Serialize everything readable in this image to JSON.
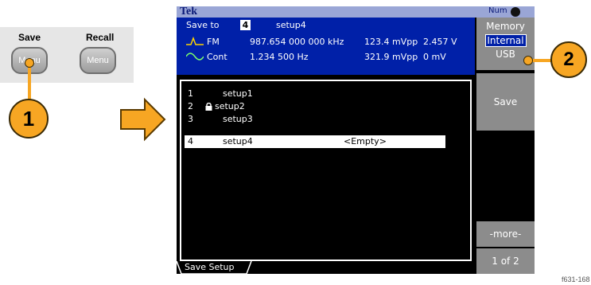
{
  "panel": {
    "save_label": "Save",
    "recall_label": "Recall",
    "save_button_text": "Menu",
    "recall_button_text": "Menu"
  },
  "callouts": {
    "first": "1",
    "second": "2"
  },
  "screen": {
    "brand": "Tek",
    "status": "Num",
    "save_to_label": "Save to",
    "slot": "4",
    "setup_name": "setup4",
    "channels": [
      {
        "mode": "FM",
        "freq": "987.654 000 000 kHz",
        "amplitude": "123.4 mVpp",
        "offset": "2.457 V"
      },
      {
        "mode": "Cont",
        "freq": "1.234 500 Hz",
        "amplitude": "321.9 mVpp",
        "offset": "0 mV"
      }
    ],
    "list": [
      {
        "num": "1",
        "name": "setup1",
        "status": "",
        "locked": false
      },
      {
        "num": "2",
        "name": "setup2",
        "status": "",
        "locked": true
      },
      {
        "num": "3",
        "name": "setup3",
        "status": "",
        "locked": false
      },
      {
        "num": "4",
        "name": "setup4",
        "status": "<Empty>",
        "locked": false
      }
    ],
    "tab_label": "Save Setup",
    "side": {
      "memory_title": "Memory",
      "internal": "Internal",
      "usb": "USB",
      "save": "Save",
      "more": "-more-",
      "page": "1 of 2"
    }
  },
  "figure_id": "f631-168",
  "colors": {
    "accent": "#f7a623",
    "panel_blue": "#0020a8",
    "softkey_gray": "#8c8c8c"
  }
}
